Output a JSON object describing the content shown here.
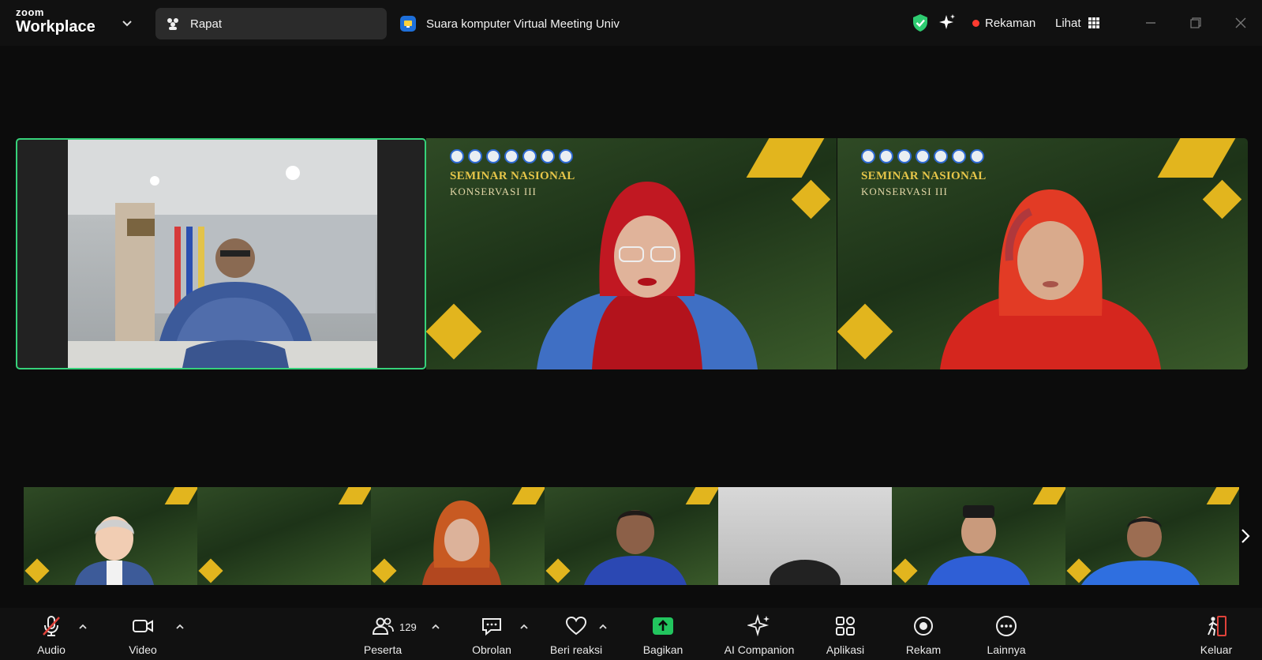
{
  "topbar": {
    "brand_top": "zoom",
    "brand_bottom": "Workplace",
    "meeting_tab": "Rapat",
    "audio_tab": "Suara komputer Virtual Meeting Univ",
    "recording": "Rekaman",
    "view": "Lihat",
    "icons": [
      "chevron-down-icon",
      "meeting-icon",
      "audio-icon",
      "shield-check-icon",
      "sparkle-icon",
      "grid-icon",
      "minimize-icon",
      "restore-icon",
      "close-icon"
    ],
    "record_color": "#ff3b30",
    "shield_color": "#2ecc71"
  },
  "tiles": {
    "seminar_title": "SEMINAR NASIONAL",
    "seminar_sub": "KONSERVASI III",
    "active_speaker_border": "#36d27a",
    "gold_color": "#e2b51e"
  },
  "toolbar": {
    "audio": "Audio",
    "video": "Video",
    "participants": "Peserta",
    "participants_count": "129",
    "chat": "Obrolan",
    "react": "Beri reaksi",
    "share": "Bagikan",
    "ai": "AI Companion",
    "apps": "Aplikasi",
    "record": "Rekam",
    "more": "Lainnya",
    "leave": "Keluar",
    "share_color": "#22c55e",
    "leave_color": "#e0423a"
  }
}
